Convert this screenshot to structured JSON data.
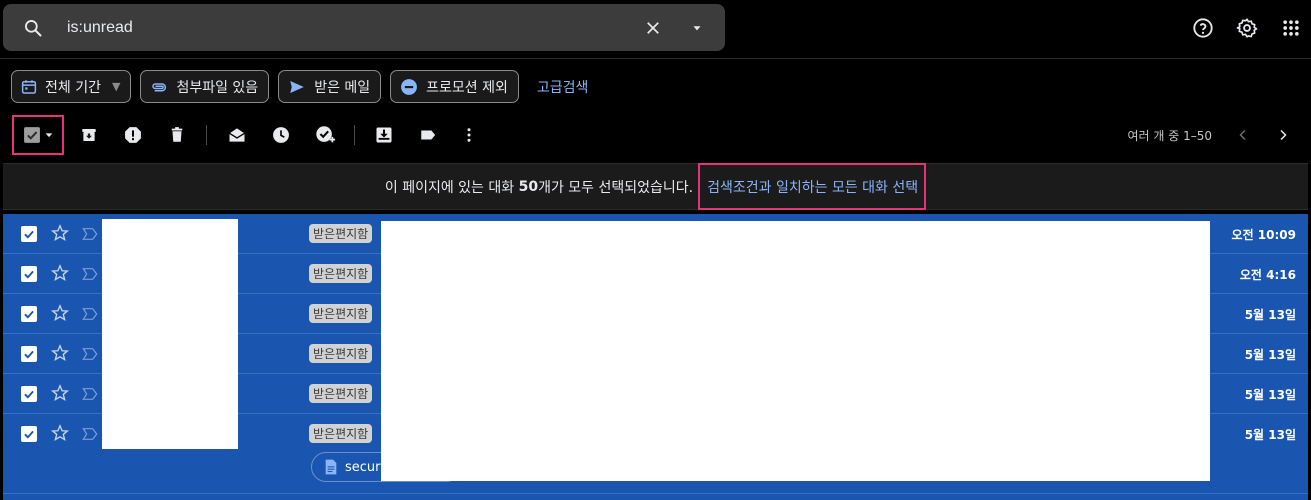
{
  "search": {
    "query": "is:unread"
  },
  "icons": {
    "search": "search-icon",
    "clear": "close-icon",
    "options": "caret-down-icon",
    "help": "help-icon",
    "settings": "gear-icon",
    "apps": "apps-grid-icon"
  },
  "chips": [
    {
      "label": "전체 기간",
      "icon": "calendar-icon"
    },
    {
      "label": "첨부파일 있음",
      "icon": "paperclip-icon"
    },
    {
      "label": "받은 메일",
      "icon": "send-icon"
    },
    {
      "label": "프로모션 제외",
      "icon": "minus-circle-icon"
    }
  ],
  "advanced_search": "고급검색",
  "pager": {
    "text": "여러 개 중 1–50"
  },
  "banner": {
    "prefix": "이 페이지에 있는 대화 ",
    "count": "50",
    "suffix": "개가 모두 선택되었습니다.",
    "link": "검색조건과 일치하는 모든 대화 선택"
  },
  "emails": [
    {
      "label": "받은편지함",
      "date": "오전 10:09"
    },
    {
      "label": "받은편지함",
      "date": "오전 4:16"
    },
    {
      "label": "받은편지함",
      "date": "5월 13일"
    },
    {
      "label": "받은편지함",
      "date": "5월 13일"
    },
    {
      "label": "받은편지함",
      "date": "5월 13일"
    },
    {
      "label": "받은편지함",
      "date": "5월 13일"
    }
  ],
  "attachment": {
    "name": "secur"
  },
  "colors": {
    "selected_row": "#1a56b0",
    "highlight": "#e8337a",
    "link": "#8ab4f8"
  }
}
